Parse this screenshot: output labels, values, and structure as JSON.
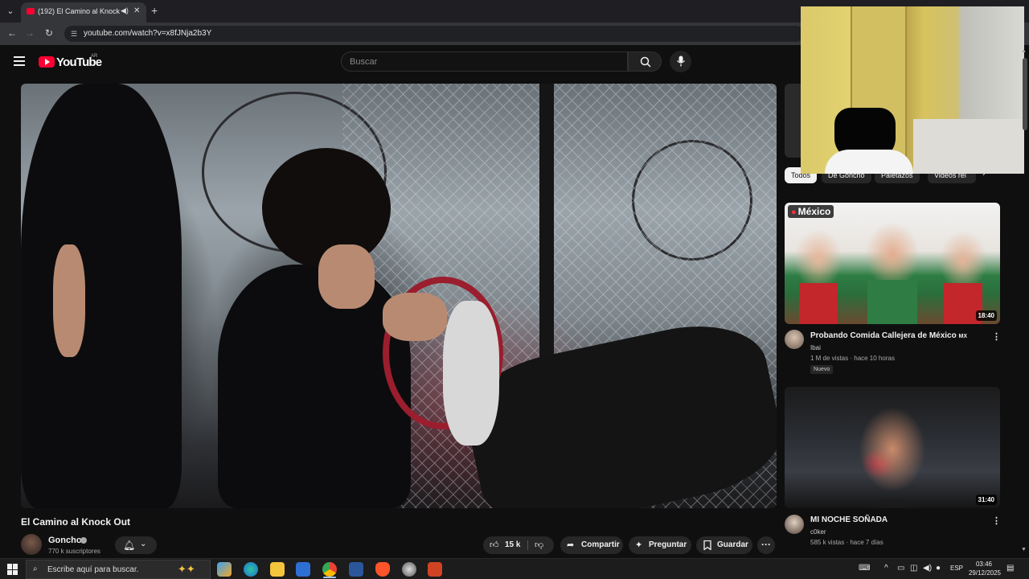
{
  "browser": {
    "tab_title": "(192) El Camino al Knock Ou",
    "tab_audio_icon": "speaker-icon",
    "tab_close": "✕",
    "new_tab": "+",
    "url": "youtube.com/watch?v=x8fJNja2b3Y"
  },
  "header": {
    "logo_text": "YouTube",
    "country_code": "AR",
    "search_placeholder": "Buscar"
  },
  "video": {
    "title": "El Camino al Knock Out",
    "channel_name": "Goncho",
    "channel_subs": "770 k suscriptores",
    "like_count": "15 k",
    "share_label": "Compartir",
    "ask_label": "Preguntar",
    "save_label": "Guardar",
    "more_label": "···"
  },
  "chips": [
    {
      "label": "Todos",
      "active": true
    },
    {
      "label": "De Goncho"
    },
    {
      "label": "Paletazos"
    },
    {
      "label": "Videos rel"
    }
  ],
  "recommendations": [
    {
      "title": "Probando Comida Callejera de México",
      "title_suffix": "MX",
      "channel": "Ibai",
      "meta": "1 M de vistas · hace 10 horas",
      "badge": "Nuevo",
      "duration": "18:40",
      "location_badge": "México"
    },
    {
      "title": "MI NOCHE SOÑADA",
      "channel": "c0ker",
      "meta": "585 k vistas · hace 7 días",
      "duration": "31:40"
    }
  ],
  "taskbar": {
    "search_text": "Escribe aquí para buscar.",
    "language": "ESP",
    "time": "03:46",
    "date": "29/12/2025"
  },
  "colors": {
    "yt_red": "#ff0033",
    "background": "#0f0f0f",
    "pill_bg": "#272727"
  }
}
